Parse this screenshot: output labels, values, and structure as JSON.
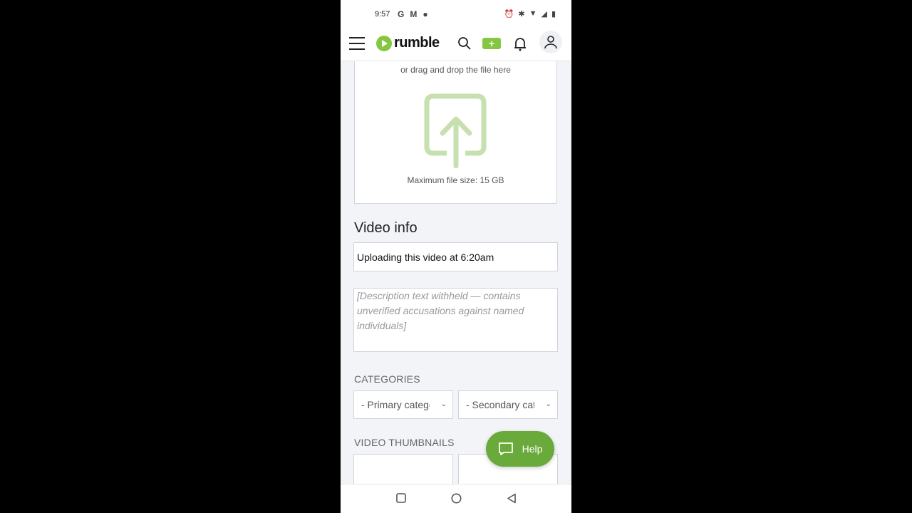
{
  "status_bar": {
    "time": "9:57",
    "left_icons": [
      "google-icon",
      "gmail-icon",
      "location-icon"
    ],
    "right_icons": [
      "alarm-icon",
      "bluetooth-icon",
      "wifi-icon",
      "signal-icon",
      "battery-icon"
    ]
  },
  "header": {
    "brand": "rumble",
    "brand_color": "#85c742",
    "icons": [
      "menu-icon",
      "search-icon",
      "upload-video-icon",
      "bell-icon",
      "user-icon"
    ]
  },
  "upload": {
    "drag_text": "or drag and drop the file here",
    "max_size": "Maximum file size: 15 GB",
    "icon_color": "#c7e0b0"
  },
  "video_info": {
    "section_title": "Video info",
    "title_value": "Uploading this video at 6:20am",
    "description_value": "[Description text withheld — contains unverified accusations against named individuals]"
  },
  "categories": {
    "label": "CATEGORIES",
    "primary": "- Primary category -",
    "secondary": "- Secondary category -"
  },
  "thumbnails": {
    "label": "VIDEO THUMBNAILS"
  },
  "help_button": {
    "label": "Help",
    "color": "#6aaa3a"
  },
  "system_nav": [
    "recents-icon",
    "home-icon",
    "back-icon"
  ]
}
